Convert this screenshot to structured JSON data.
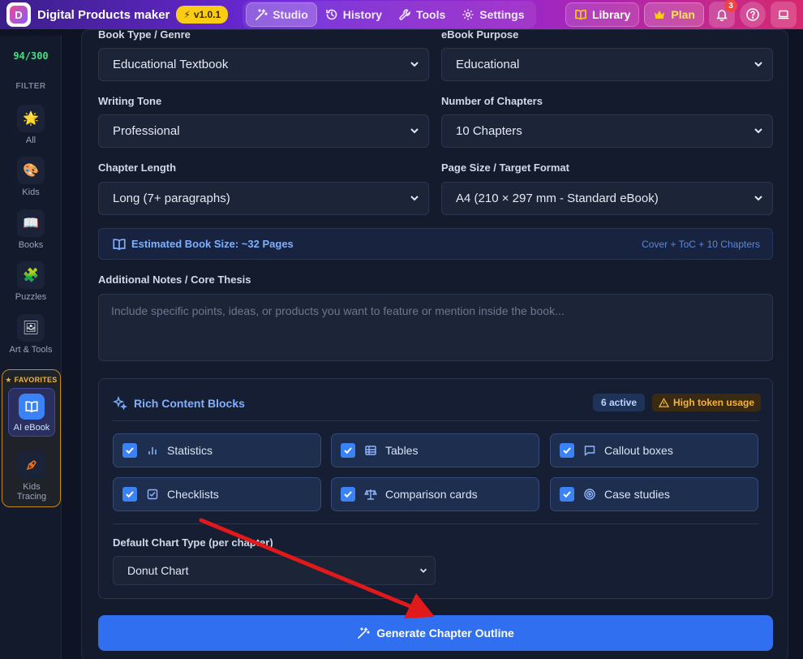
{
  "header": {
    "brand_logo_letter": "D",
    "brand_name": "Digital Products maker",
    "version": "v1.0.1",
    "nav": [
      {
        "label": "Studio",
        "icon": "magic-wand-icon",
        "active": true
      },
      {
        "label": "History",
        "icon": "history-icon",
        "active": false
      },
      {
        "label": "Tools",
        "icon": "wrench-icon",
        "active": false
      },
      {
        "label": "Settings",
        "icon": "gear-icon",
        "active": false
      }
    ],
    "library_label": "Library",
    "plan_label": "Plan",
    "notification_count": "3"
  },
  "sidebar": {
    "counter": "94/300",
    "filter_label": "FILTER",
    "items": [
      {
        "label": "All",
        "icon": "sun-icon"
      },
      {
        "label": "Kids",
        "icon": "palette-icon"
      },
      {
        "label": "Books",
        "icon": "book-icon"
      },
      {
        "label": "Puzzles",
        "icon": "puzzle-icon"
      },
      {
        "label": "Art & Tools",
        "icon": "picture-icon"
      }
    ],
    "favorites_label": "FAVORITES",
    "favorites": [
      {
        "label": "AI eBook",
        "icon": "open-book-icon",
        "active": true
      },
      {
        "label": "Kids Tracing",
        "icon": "pen-nib-icon",
        "active": false
      }
    ]
  },
  "form": {
    "book_type_label": "Book Type / Genre",
    "book_type_value": "Educational Textbook",
    "purpose_label": "eBook Purpose",
    "purpose_value": "Educational",
    "tone_label": "Writing Tone",
    "tone_value": "Professional",
    "chapters_label": "Number of Chapters",
    "chapters_value": "10 Chapters",
    "length_label": "Chapter Length",
    "length_value": "Long (7+ paragraphs)",
    "page_size_label": "Page Size / Target Format",
    "page_size_value": "A4 (210 × 297 mm - Standard eBook)",
    "estimate_text": "Estimated Book Size: ~32 Pages",
    "estimate_detail": "Cover + ToC + 10 Chapters",
    "notes_label": "Additional Notes / Core Thesis",
    "notes_placeholder": "Include specific points, ideas, or products you want to feature or mention inside the book..."
  },
  "rich_blocks": {
    "title": "Rich Content Blocks",
    "active_count": "6 active",
    "warning": "High token usage",
    "options": [
      {
        "label": "Statistics",
        "icon": "bar-chart-icon",
        "checked": true
      },
      {
        "label": "Tables",
        "icon": "table-icon",
        "checked": true
      },
      {
        "label": "Callout boxes",
        "icon": "speech-bubble-icon",
        "checked": true
      },
      {
        "label": "Checklists",
        "icon": "checklist-icon",
        "checked": true
      },
      {
        "label": "Comparison cards",
        "icon": "scale-icon",
        "checked": true
      },
      {
        "label": "Case studies",
        "icon": "target-icon",
        "checked": true
      }
    ],
    "chart_type_label": "Default Chart Type (per chapter)",
    "chart_type_value": "Donut Chart"
  },
  "generate_label": "Generate Chapter Outline",
  "colors": {
    "accent": "#2f6ff0",
    "warning": "#f2b43a",
    "annotation_arrow": "#e0191b"
  }
}
